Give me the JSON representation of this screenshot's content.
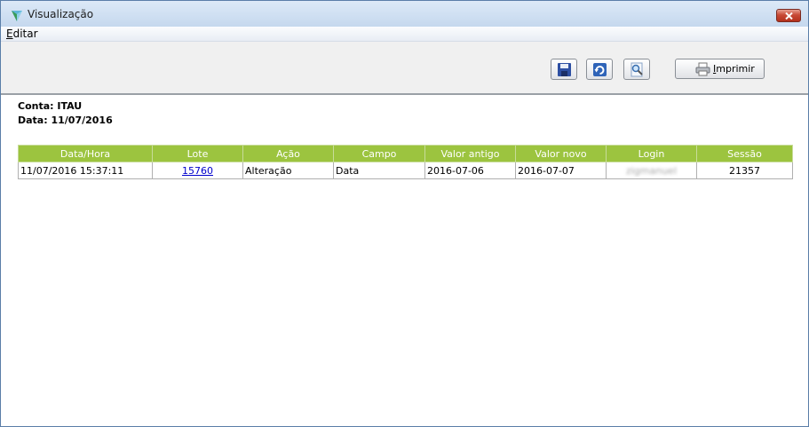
{
  "window": {
    "title": "Visualização"
  },
  "menu": {
    "editar": {
      "underlined": "E",
      "rest": "ditar"
    }
  },
  "toolbar": {
    "save_icon": "floppy-save-icon",
    "refresh_icon": "refresh-icon",
    "zoom_icon": "magnifier-preview-icon",
    "print": {
      "underlined": "I",
      "rest": "mprimir",
      "icon": "printer-icon"
    }
  },
  "info": {
    "conta": "Conta: ITAU",
    "data": "Data: 11/07/2016"
  },
  "table": {
    "headers": [
      "Data/Hora",
      "Lote",
      "Ação",
      "Campo",
      "Valor antigo",
      "Valor novo",
      "Login",
      "Sessão"
    ],
    "rows": [
      [
        "11/07/2016 15:37:11",
        "15760",
        "Alteração",
        "Data",
        "2016-07-06",
        "2016-07-07",
        "zigmanuel",
        "21357"
      ]
    ]
  },
  "colors": {
    "header_green": "#9cc43f",
    "link_blue": "#0000cc"
  }
}
